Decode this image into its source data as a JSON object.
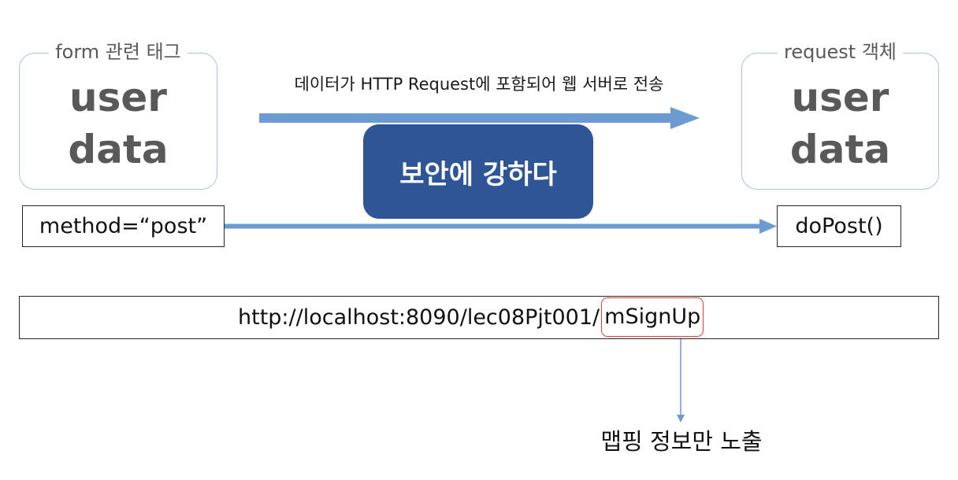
{
  "left_panel": {
    "caption": "form 관련 태그",
    "line1": "user",
    "line2": "data"
  },
  "right_panel": {
    "caption": "request 객체",
    "line1": "user",
    "line2": "data"
  },
  "flow": {
    "caption": "데이터가 HTTP Request에 포함되어 웹 서버로 전송"
  },
  "security": {
    "label": "보안에 강하다"
  },
  "method_box": {
    "text": "method=“post”"
  },
  "dopost_box": {
    "text": "doPost()"
  },
  "url": {
    "prefix": "http://localhost:8090/lec08Pjt001/",
    "highlight": "mSignUp"
  },
  "mapping_note": {
    "text": "맵핑 정보만 노출"
  },
  "colors": {
    "arrow": "#6c9bd2",
    "panel_border": "#a9c2e2",
    "security_box": "#2f5597",
    "highlight_border": "#e03b3b",
    "label_gray": "#595959"
  }
}
